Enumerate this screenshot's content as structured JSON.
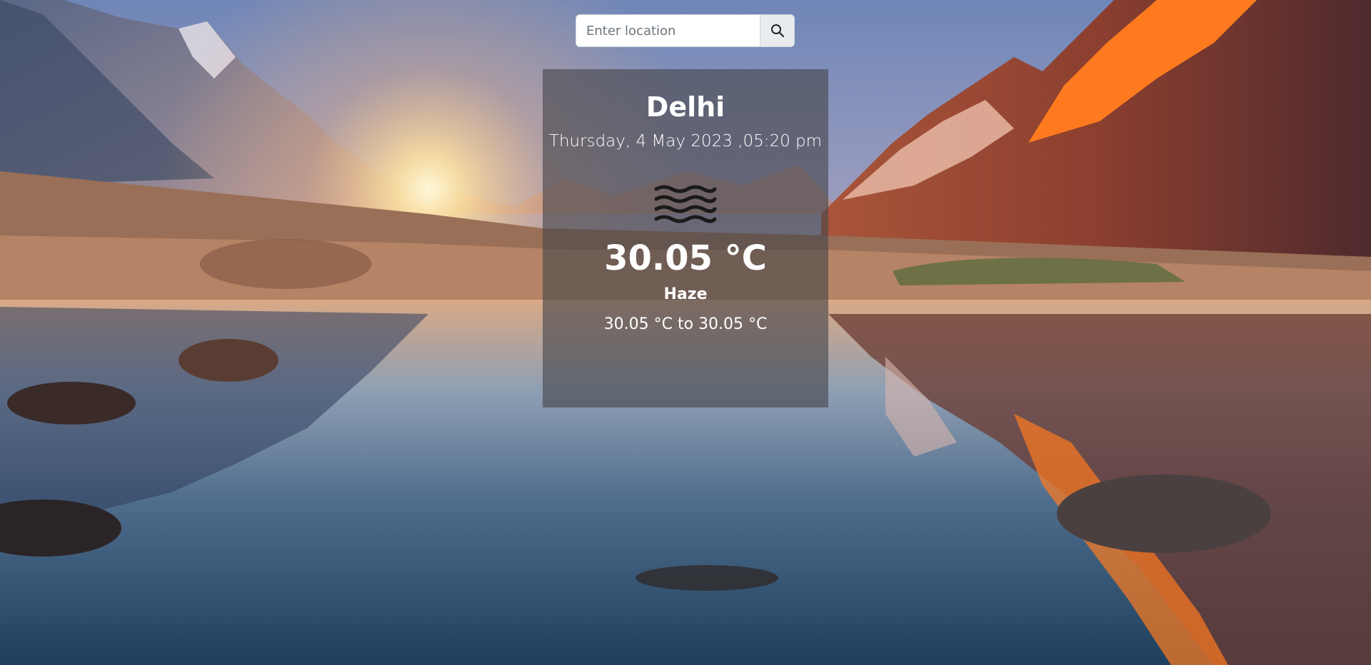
{
  "search": {
    "placeholder": "Enter location",
    "value": "",
    "button_icon": "search-icon"
  },
  "weather": {
    "city": "Delhi",
    "datetime": "Thursday, 4 May 2023 ,05:20 pm",
    "icon": "haze-icon",
    "temperature": "30.05 °C",
    "condition": "Haze",
    "range": "30.05 °C to 30.05 °C"
  },
  "colors": {
    "card_background": "#46464b",
    "text": "#ffffff",
    "input_border": "#ced4da",
    "button_background": "#e9ecef"
  }
}
